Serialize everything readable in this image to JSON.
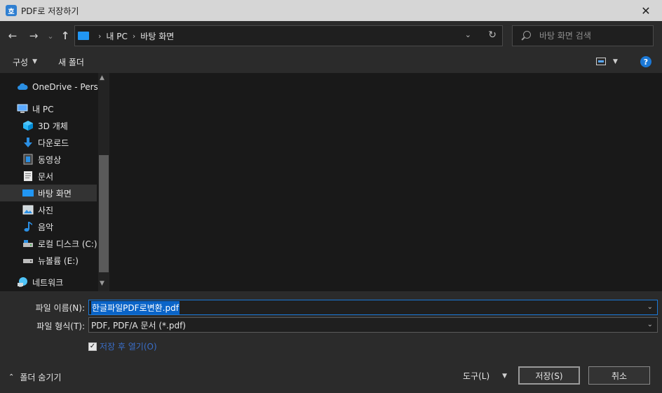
{
  "window": {
    "title": "PDF로 저장하기",
    "app_icon_glyph": "호",
    "close_glyph": "✕"
  },
  "navbar": {
    "back_glyph": "←",
    "forward_glyph": "→",
    "recent_glyph": "⌄",
    "up_glyph": "↑",
    "breadcrumb": [
      "내 PC",
      "바탕 화면"
    ],
    "breadcrumb_sep": "›",
    "dropdown_glyph": "⌄",
    "refresh_glyph": "↻",
    "search_placeholder": "바탕 화면 검색"
  },
  "toolbar": {
    "organize_label": "구성",
    "organize_caret": "▼",
    "new_folder_label": "새 폴더",
    "view_caret": "▼",
    "help_glyph": "?"
  },
  "sidebar": {
    "items": [
      {
        "label": "OneDrive - Personal",
        "icon": "cloud-icon",
        "indent": 1
      },
      {
        "label": "내 PC",
        "icon": "computer-icon",
        "indent": 1
      },
      {
        "label": "3D 개체",
        "icon": "cube-icon",
        "indent": 2
      },
      {
        "label": "다운로드",
        "icon": "download-icon",
        "indent": 2
      },
      {
        "label": "동영상",
        "icon": "video-icon",
        "indent": 2
      },
      {
        "label": "문서",
        "icon": "document-icon",
        "indent": 2
      },
      {
        "label": "바탕 화면",
        "icon": "desktop-icon",
        "indent": 2,
        "selected": true
      },
      {
        "label": "사진",
        "icon": "picture-icon",
        "indent": 2
      },
      {
        "label": "음악",
        "icon": "music-icon",
        "indent": 2
      },
      {
        "label": "로컬 디스크 (C:)",
        "icon": "drive-icon",
        "indent": 2
      },
      {
        "label": "뉴볼륨 (E:)",
        "icon": "drive-icon",
        "indent": 2
      },
      {
        "label": "네트워크",
        "icon": "network-icon",
        "indent": 1
      }
    ],
    "scroll_up_glyph": "▲",
    "scroll_down_glyph": "▼"
  },
  "form": {
    "filename_label": "파일 이름(N):",
    "filename_value": "한글파일PDF로변환.pdf",
    "filetype_label": "파일 형식(T):",
    "filetype_value": "PDF, PDF/A 문서 (*.pdf)",
    "dropdown_glyph": "⌄",
    "open_after_save_label": "저장 후 열기(O)",
    "open_after_save_checked": true,
    "check_glyph": "✓"
  },
  "footer": {
    "hide_folders_glyph": "⌃",
    "hide_folders_label": "폴더 숨기기",
    "tools_label": "도구(L)",
    "tools_caret": "▼",
    "save_label": "저장(S)",
    "cancel_label": "취소"
  },
  "colors": {
    "accent": "#1b78d6",
    "selection": "#0a64c8",
    "background": "#191919",
    "panel": "#2b2b2b"
  }
}
